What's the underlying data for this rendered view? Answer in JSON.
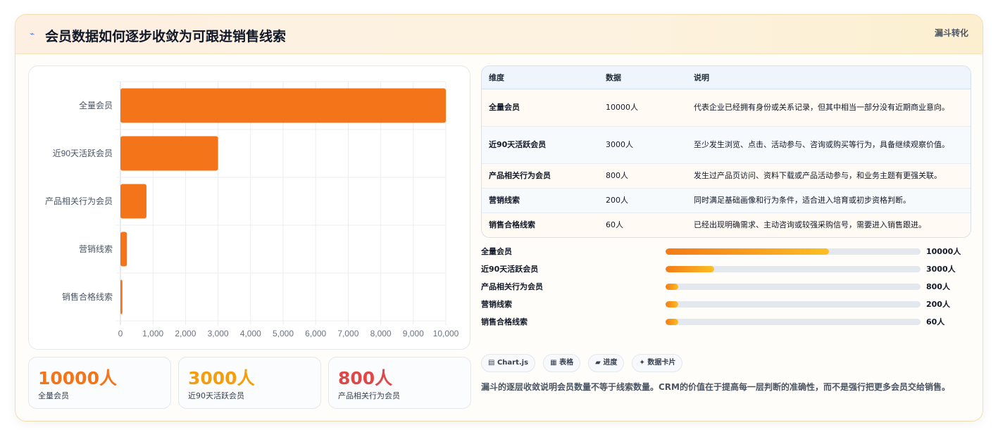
{
  "header": {
    "icon": "lightning-icon",
    "title": "会员数据如何逐步收敛为可跟进销售线索",
    "tag": "漏斗转化"
  },
  "chart_data": {
    "type": "bar",
    "orientation": "horizontal",
    "categories": [
      "全量会员",
      "近90天活跃会员",
      "产品相关行为会员",
      "营销线索",
      "销售合格线索"
    ],
    "values": [
      10000,
      3000,
      800,
      200,
      60
    ],
    "xlim": [
      0,
      10000
    ],
    "xticks": [
      "0",
      "1,000",
      "2,000",
      "3,000",
      "4,000",
      "5,000",
      "6,000",
      "7,000",
      "8,000",
      "9,000",
      "10,000"
    ],
    "grid": true,
    "bar_color": "#f47519"
  },
  "stats": [
    {
      "value": "10000人",
      "label": "全量会员",
      "color": "#f47519"
    },
    {
      "value": "3000人",
      "label": "近90天活跃会员",
      "color": "#f59e0b"
    },
    {
      "value": "800人",
      "label": "产品相关行为会员",
      "color": "#e04848"
    }
  ],
  "table": {
    "headers": [
      "维度",
      "数据",
      "说明"
    ],
    "rows": [
      [
        "全量会员",
        "10000人",
        "代表企业已经拥有身份或关系记录，但其中相当一部分没有近期商业意向。"
      ],
      [
        "近90天活跃会员",
        "3000人",
        "至少发生浏览、点击、活动参与、咨询或购买等行为，具备继续观察价值。"
      ],
      [
        "产品相关行为会员",
        "800人",
        "发生过产品页访问、资料下载或产品活动参与，和业务主题有更强关联。"
      ],
      [
        "营销线索",
        "200人",
        "同时满足基础画像和行为条件，适合进入培育或初步资格判断。"
      ],
      [
        "销售合格线索",
        "60人",
        "已经出现明确需求、主动咨询或较强采购信号，需要进入销售跟进。"
      ]
    ]
  },
  "progress": [
    {
      "label": "全量会员",
      "value": "10000人",
      "fraction": 0.64
    },
    {
      "label": "近90天活跃会员",
      "value": "3000人",
      "fraction": 0.19
    },
    {
      "label": "产品相关行为会员",
      "value": "800人",
      "fraction": 0.05
    },
    {
      "label": "营销线索",
      "value": "200人",
      "fraction": 0.05
    },
    {
      "label": "销售合格线索",
      "value": "60人",
      "fraction": 0.05
    }
  ],
  "chips": [
    {
      "icon": "chart-icon",
      "glyph": "▤",
      "label": "Chart.js"
    },
    {
      "icon": "table-icon",
      "glyph": "▦",
      "label": "表格"
    },
    {
      "icon": "progress-icon",
      "glyph": "▰",
      "label": "进度"
    },
    {
      "icon": "sparkle-icon",
      "glyph": "✦",
      "label": "数据卡片"
    }
  ],
  "note": "漏斗的逐层收敛说明会员数量不等于线索数量。CRM的价值在于提高每一层判断的准确性，而不是强行把更多会员交给销售。"
}
